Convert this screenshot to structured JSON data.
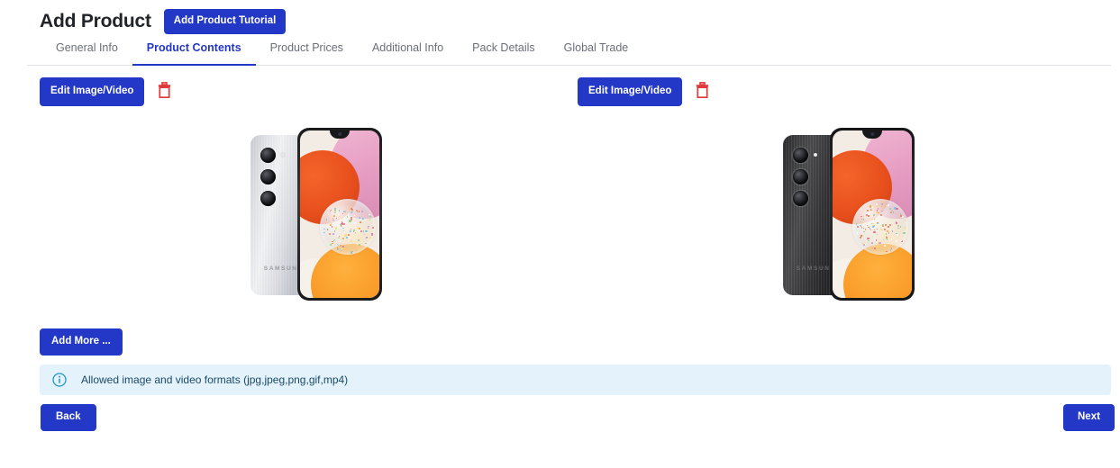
{
  "header": {
    "title": "Add Product",
    "tutorial_button": "Add Product Tutorial"
  },
  "tabs": [
    {
      "label": "General Info",
      "active": false
    },
    {
      "label": "Product Contents",
      "active": true
    },
    {
      "label": "Product Prices",
      "active": false
    },
    {
      "label": "Additional Info",
      "active": false
    },
    {
      "label": "Pack Details",
      "active": false
    },
    {
      "label": "Global Trade",
      "active": false
    }
  ],
  "media_items": [
    {
      "edit_label": "Edit Image/Video",
      "delete_icon": "trash-icon",
      "image_alt": "Samsung Galaxy A14 silver smartphone front and back",
      "variant": "silver",
      "brand_mark": "SAMSUNG"
    },
    {
      "edit_label": "Edit Image/Video",
      "delete_icon": "trash-icon",
      "image_alt": "Samsung Galaxy A14 black smartphone front and back",
      "variant": "black",
      "brand_mark": "SAMSUNG"
    }
  ],
  "add_more_label": "Add More ...",
  "info_banner": {
    "icon": "info-circle-icon",
    "text": "Allowed image and video formats (jpg,jpeg,png,gif,mp4)"
  },
  "footer": {
    "back_label": "Back",
    "next_label": "Next"
  },
  "colors": {
    "primary": "#2438c8",
    "active_tab": "#2438c8",
    "tab_inactive": "#6a6f78",
    "danger": "#e03a3a",
    "info_bg": "#e3f2fb",
    "info_fg": "#1b4a66",
    "divider": "#dfe1e5",
    "page_bg": "#ffffff"
  }
}
